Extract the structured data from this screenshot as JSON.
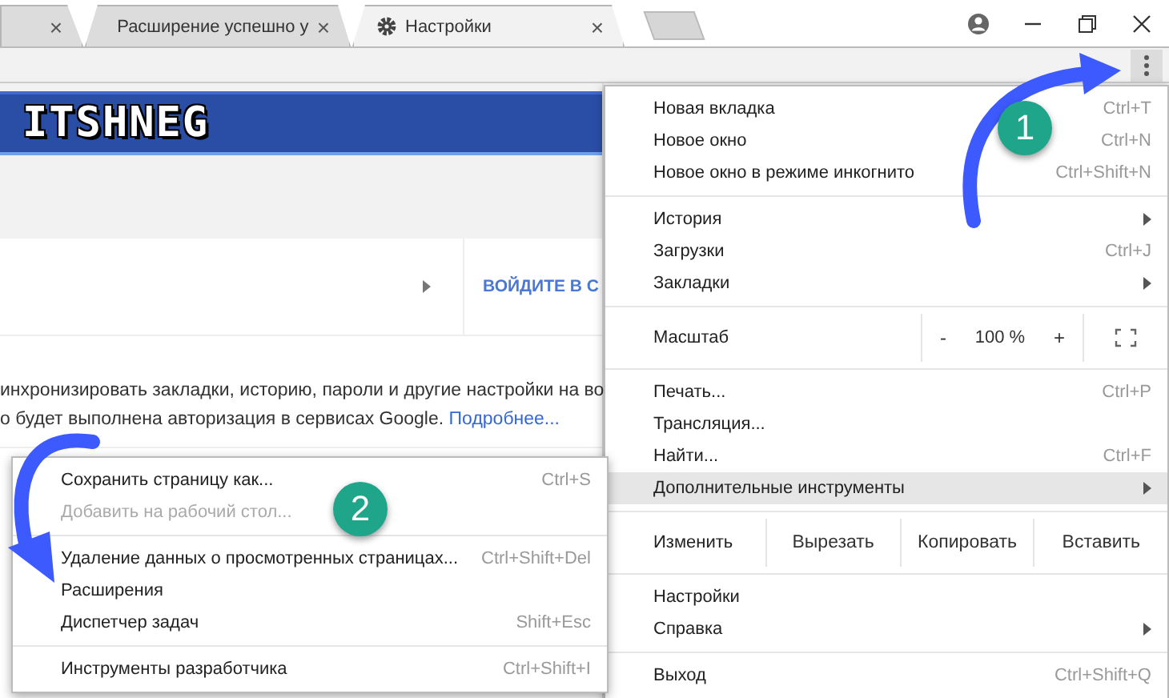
{
  "tabs": [
    {
      "kind": "partial",
      "selected": false,
      "close": "×"
    },
    {
      "kind": "page",
      "title": "Расширение успешно у",
      "selected": false,
      "close": "×"
    },
    {
      "kind": "settings",
      "title": "Настройки",
      "selected": true,
      "close": "×"
    }
  ],
  "page": {
    "logo": "ITSHNEG",
    "signin_link": "ВОЙДИТЕ В С",
    "sync_lines": [
      "инхронизировать закладки, историю, пароли и другие настройки на во",
      "о будет выполнена авторизация в сервисах Google."
    ],
    "more_link": "Подробнее..."
  },
  "menu": {
    "items": [
      {
        "kind": "item",
        "label": "Новая вкладка",
        "shortcut": "Ctrl+T",
        "has_submenu": false,
        "selected": false
      },
      {
        "kind": "item",
        "label": "Новое окно",
        "shortcut": "Ctrl+N",
        "has_submenu": false,
        "selected": false
      },
      {
        "kind": "item",
        "label": "Новое окно в режиме инкогнито",
        "shortcut": "Ctrl+Shift+N",
        "has_submenu": false,
        "selected": false
      },
      {
        "kind": "separator"
      },
      {
        "kind": "item",
        "label": "История",
        "has_submenu": true,
        "selected": false
      },
      {
        "kind": "item",
        "label": "Загрузки",
        "shortcut": "Ctrl+J",
        "has_submenu": false,
        "selected": false
      },
      {
        "kind": "item",
        "label": "Закладки",
        "has_submenu": true,
        "selected": false
      },
      {
        "kind": "separator"
      },
      {
        "kind": "zoom",
        "label": "Масштаб",
        "minus": "-",
        "value": "100 %",
        "plus": "+"
      },
      {
        "kind": "separator"
      },
      {
        "kind": "item",
        "label": "Печать...",
        "shortcut": "Ctrl+P",
        "has_submenu": false,
        "selected": false
      },
      {
        "kind": "item",
        "label": "Трансляция...",
        "has_submenu": false,
        "selected": false
      },
      {
        "kind": "item",
        "label": "Найти...",
        "shortcut": "Ctrl+F",
        "has_submenu": false,
        "selected": false
      },
      {
        "kind": "item",
        "label": "Дополнительные инструменты",
        "has_submenu": true,
        "selected": true
      },
      {
        "kind": "separator"
      },
      {
        "kind": "edit",
        "label": "Изменить",
        "buttons": [
          "Вырезать",
          "Копировать",
          "Вставить"
        ]
      },
      {
        "kind": "separator"
      },
      {
        "kind": "item",
        "label": "Настройки",
        "has_submenu": false,
        "selected": false
      },
      {
        "kind": "item",
        "label": "Справка",
        "has_submenu": true,
        "selected": false
      },
      {
        "kind": "separator"
      },
      {
        "kind": "item",
        "label": "Выход",
        "shortcut": "Ctrl+Shift+Q",
        "has_submenu": false,
        "selected": false
      }
    ]
  },
  "submenu": {
    "items": [
      {
        "kind": "item",
        "label": "Сохранить страницу как...",
        "shortcut": "Ctrl+S",
        "disabled": false
      },
      {
        "kind": "item",
        "label": "Добавить на рабочий стол...",
        "disabled": true
      },
      {
        "kind": "separator"
      },
      {
        "kind": "item",
        "label": "Удаление данных о просмотренных страницах...",
        "shortcut": "Ctrl+Shift+Del",
        "disabled": false
      },
      {
        "kind": "item",
        "label": "Расширения",
        "disabled": false
      },
      {
        "kind": "item",
        "label": "Диспетчер задач",
        "shortcut": "Shift+Esc",
        "disabled": false
      },
      {
        "kind": "separator"
      },
      {
        "kind": "item",
        "label": "Инструменты разработчика",
        "shortcut": "Ctrl+Shift+I",
        "disabled": false
      }
    ]
  },
  "annotations": [
    {
      "number": "1"
    },
    {
      "number": "2"
    }
  ]
}
